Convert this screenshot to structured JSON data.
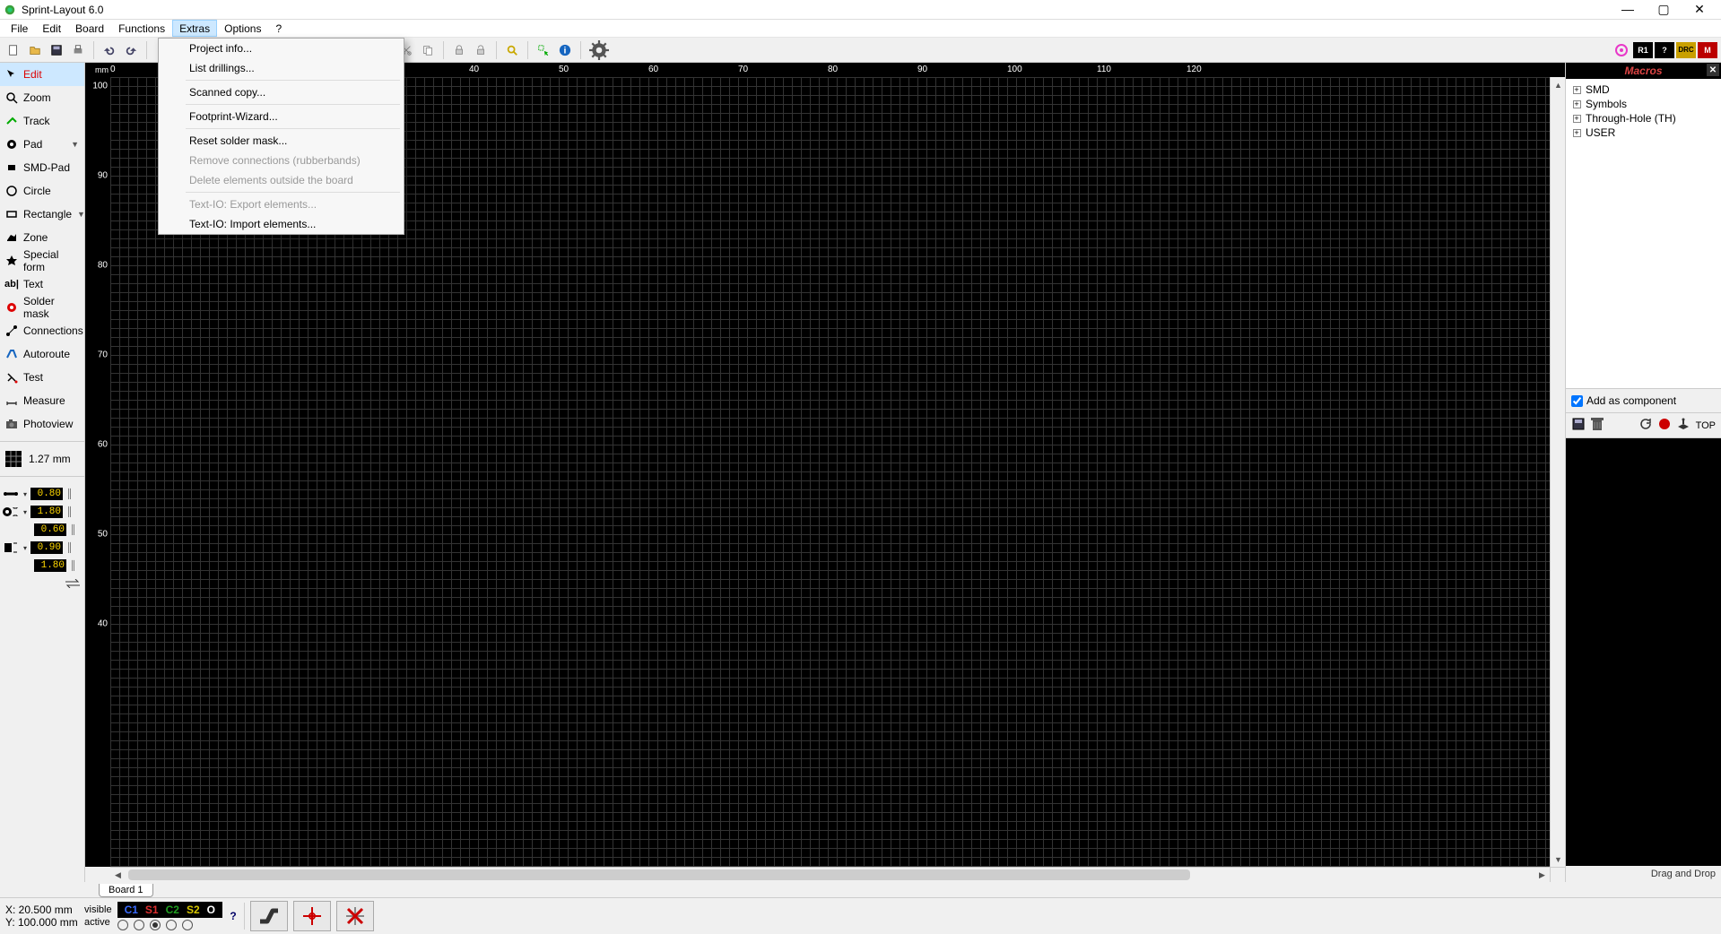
{
  "title": "Sprint-Layout 6.0",
  "menubar": {
    "items": [
      "File",
      "Edit",
      "Board",
      "Functions",
      "Extras",
      "Options",
      "?"
    ],
    "highlighted": "Extras"
  },
  "dropdown": {
    "items": [
      {
        "label": "Project info...",
        "enabled": true
      },
      {
        "label": "List drillings...",
        "enabled": true
      },
      {
        "sep": true
      },
      {
        "label": "Scanned copy...",
        "enabled": true
      },
      {
        "sep": true
      },
      {
        "label": "Footprint-Wizard...",
        "enabled": true
      },
      {
        "sep": true
      },
      {
        "label": "Reset solder mask...",
        "enabled": true
      },
      {
        "label": "Remove connections (rubberbands)",
        "enabled": false
      },
      {
        "label": "Delete elements outside the board",
        "enabled": false
      },
      {
        "sep": true
      },
      {
        "label": "Text-IO: Export elements...",
        "enabled": false
      },
      {
        "label": "Text-IO: Import elements...",
        "enabled": true
      }
    ]
  },
  "left_tools": [
    {
      "name": "edit",
      "label": "Edit",
      "active": true
    },
    {
      "name": "zoom",
      "label": "Zoom"
    },
    {
      "name": "track",
      "label": "Track"
    },
    {
      "name": "pad",
      "label": "Pad",
      "chev": true
    },
    {
      "name": "smd-pad",
      "label": "SMD-Pad"
    },
    {
      "name": "circle",
      "label": "Circle"
    },
    {
      "name": "rectangle",
      "label": "Rectangle",
      "chev": true
    },
    {
      "name": "zone",
      "label": "Zone"
    },
    {
      "name": "special-form",
      "label": "Special form"
    },
    {
      "name": "text",
      "label": "Text"
    },
    {
      "name": "solder-mask",
      "label": "Solder mask"
    },
    {
      "name": "connections",
      "label": "Connections"
    },
    {
      "name": "autoroute",
      "label": "Autoroute"
    },
    {
      "name": "test",
      "label": "Test"
    },
    {
      "name": "measure",
      "label": "Measure"
    },
    {
      "name": "photoview",
      "label": "Photoview"
    }
  ],
  "grid_size": "1.27 mm",
  "params": {
    "track_width": "0.80",
    "pad_outer": "1.80",
    "pad_inner": "0.60",
    "smd_w": "0.90",
    "smd_h": "1.80"
  },
  "ruler": {
    "unit": "mm",
    "h_ticks": [
      "0",
      "40",
      "50",
      "60",
      "70",
      "80",
      "90",
      "100",
      "110",
      "120"
    ],
    "h_positions": [
      0,
      400,
      500,
      600,
      700,
      800,
      900,
      1000,
      1100,
      1200
    ],
    "v_ticks": [
      "100",
      "90",
      "80",
      "70",
      "60",
      "50",
      "40"
    ],
    "v_positions": [
      10,
      110,
      210,
      310,
      410,
      510,
      610
    ]
  },
  "board_tab": "Board 1",
  "right_panel": {
    "title": "Macros",
    "tree": [
      "SMD",
      "Symbols",
      "Through-Hole (TH)",
      "USER"
    ],
    "add_component": "Add as component",
    "top_label": "TOP",
    "footer": "Drag and Drop"
  },
  "status": {
    "x": "X:   20.500 mm",
    "y": "Y: 100.000 mm",
    "visible": "visible",
    "active": "active",
    "layers": [
      {
        "name": "C1",
        "color": "#3a6bff"
      },
      {
        "name": "S1",
        "color": "#e03030"
      },
      {
        "name": "C2",
        "color": "#20a020"
      },
      {
        "name": "S2",
        "color": "#d8c800"
      },
      {
        "name": "O",
        "color": "#ffffff"
      }
    ],
    "active_layer_index": 2
  },
  "right_tools": {
    "r1": "R1",
    "drc": "DRC",
    "m": "M"
  }
}
